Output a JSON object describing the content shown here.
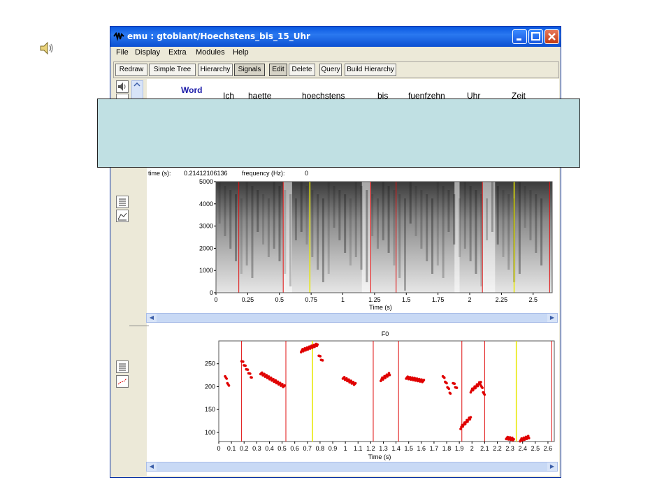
{
  "window": {
    "title": "emu : gtobiant/Hoechstens_bis_15_Uhr",
    "menu": [
      "File",
      "Display",
      "Extra",
      "Modules",
      "Help"
    ],
    "toolbar": {
      "redraw": "Redraw",
      "simple_tree": "Simple Tree",
      "hierarchy": "Hierarchy",
      "signals": "Signals",
      "edit": "Edit",
      "delete": "Delete",
      "query": "Query",
      "build_hierarchy": "Build Hierarchy"
    }
  },
  "labels": {
    "level": "Word",
    "words": [
      "Ich",
      "haette",
      "hoechstens",
      "bis",
      "fuenfzehn",
      "Uhr",
      "Zeit"
    ]
  },
  "readout": {
    "time_label": "time (s):",
    "time_value": "0.21412106136",
    "freq_label": "frequency (Hz):",
    "freq_value": "0"
  },
  "spectrogram": {
    "y_ticks": [
      "5000",
      "4000",
      "3000",
      "2000",
      "1000",
      "0"
    ],
    "y_values": [
      5000,
      4000,
      3000,
      2000,
      1000,
      0
    ],
    "x_ticks": [
      "0",
      "0.25",
      "0.5",
      "0.75",
      "1",
      "1.25",
      "1.5",
      "1.75",
      "2",
      "2.25",
      "2.5"
    ],
    "x_values": [
      0,
      0.25,
      0.5,
      0.75,
      1,
      1.25,
      1.5,
      1.75,
      2,
      2.25,
      2.5
    ],
    "xlabel": "Time (s)",
    "xlim": [
      0,
      2.65
    ],
    "boundaries_red": [
      0.18,
      0.53,
      1.22,
      1.42,
      2.1,
      2.63
    ],
    "boundaries_yellow": [
      0.74,
      2.35
    ]
  },
  "f0": {
    "title": "F0",
    "y_ticks": [
      "250",
      "200",
      "150",
      "100"
    ],
    "y_values": [
      250,
      200,
      150,
      100
    ],
    "ylim": [
      80,
      300
    ],
    "x_ticks": [
      "0",
      "0.1",
      "0.2",
      "0.3",
      "0.4",
      "0.5",
      "0.6",
      "0.7",
      "0.8",
      "0.9",
      "1",
      "1.1",
      "1.2",
      "1.3",
      "1.4",
      "1.5",
      "1.6",
      "1.7",
      "1.8",
      "1.9",
      "2",
      "2.1",
      "2.2",
      "2.3",
      "2.4",
      "2.5",
      "2.6"
    ],
    "x_values": [
      0,
      0.1,
      0.2,
      0.3,
      0.4,
      0.5,
      0.6,
      0.7,
      0.8,
      0.9,
      1,
      1.1,
      1.2,
      1.3,
      1.4,
      1.5,
      1.6,
      1.7,
      1.8,
      1.9,
      2,
      2.1,
      2.2,
      2.3,
      2.4,
      2.5,
      2.6
    ],
    "xlabel": "Time (s)",
    "xlim": [
      0,
      2.65
    ],
    "boundaries_red": [
      0.18,
      0.53,
      1.22,
      1.42,
      1.92,
      2.1,
      2.63
    ],
    "boundaries_yellow": [
      0.74,
      2.35
    ],
    "segments": [
      {
        "t0": 0.05,
        "t1": 0.08,
        "f0": 225,
        "f1": 200
      },
      {
        "t0": 0.18,
        "t1": 0.26,
        "f0": 258,
        "f1": 220
      },
      {
        "t0": 0.33,
        "t1": 0.52,
        "f0": 230,
        "f1": 200
      },
      {
        "t0": 0.65,
        "t1": 0.78,
        "f0": 278,
        "f1": 292
      },
      {
        "t0": 0.79,
        "t1": 0.82,
        "f0": 270,
        "f1": 255
      },
      {
        "t0": 0.98,
        "t1": 1.08,
        "f0": 220,
        "f1": 205
      },
      {
        "t0": 1.28,
        "t1": 1.35,
        "f0": 215,
        "f1": 228
      },
      {
        "t0": 1.48,
        "t1": 1.62,
        "f0": 220,
        "f1": 212
      },
      {
        "t0": 1.77,
        "t1": 1.83,
        "f0": 225,
        "f1": 185
      },
      {
        "t0": 1.85,
        "t1": 1.88,
        "f0": 210,
        "f1": 195
      },
      {
        "t0": 1.91,
        "t1": 1.99,
        "f0": 110,
        "f1": 133
      },
      {
        "t0": 1.99,
        "t1": 2.07,
        "f0": 190,
        "f1": 210
      },
      {
        "t0": 2.07,
        "t1": 2.1,
        "f0": 205,
        "f1": 180
      },
      {
        "t0": 2.27,
        "t1": 2.33,
        "f0": 88,
        "f1": 85
      },
      {
        "t0": 2.38,
        "t1": 2.45,
        "f0": 83,
        "f1": 90
      }
    ]
  }
}
